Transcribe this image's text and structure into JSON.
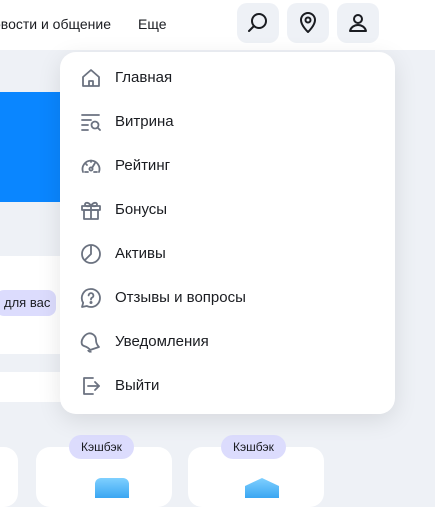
{
  "header": {
    "nav_items": [
      "овости и общение",
      "Еще"
    ],
    "icon_buttons": [
      "search-icon",
      "location-pin-icon",
      "user-icon"
    ]
  },
  "background": {
    "tag_label": "для вас",
    "cards": [
      {
        "badge": "Кэшбэк"
      },
      {
        "badge": "Кэшбэк"
      }
    ]
  },
  "menu": {
    "items": [
      {
        "label": "Главная",
        "icon": "home-icon"
      },
      {
        "label": "Витрина",
        "icon": "showcase-search-icon"
      },
      {
        "label": "Рейтинг",
        "icon": "speedometer-icon"
      },
      {
        "label": "Бонусы",
        "icon": "gift-icon"
      },
      {
        "label": "Активы",
        "icon": "pie-chart-icon"
      },
      {
        "label": "Отзывы и вопросы",
        "icon": "question-bubble-icon"
      },
      {
        "label": "Уведомления",
        "icon": "bell-icon"
      },
      {
        "label": "Выйти",
        "icon": "logout-icon"
      }
    ]
  },
  "colors": {
    "accent_blue": "#0a86ff",
    "badge_bg": "#dcdcfd",
    "page_bg": "#eef1f6",
    "icon_gray": "#6b7280"
  }
}
